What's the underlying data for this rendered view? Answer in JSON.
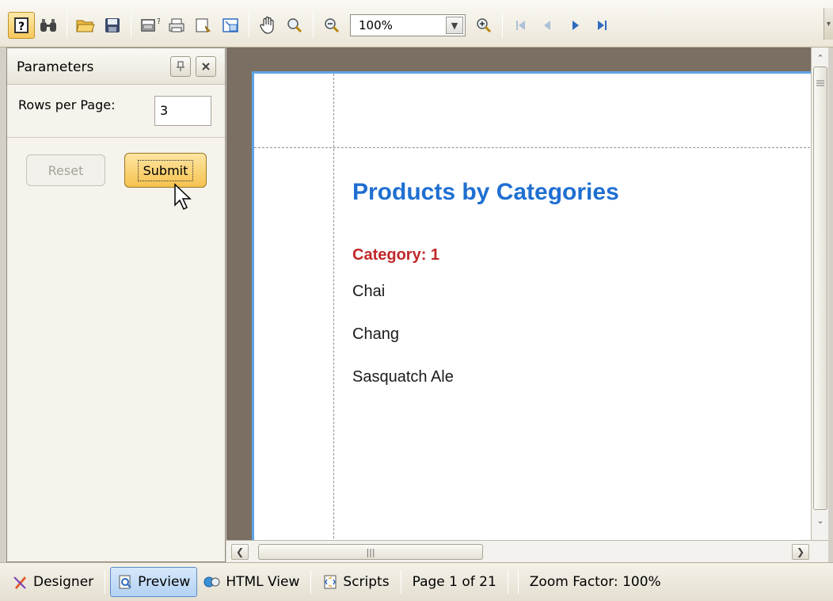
{
  "toolbar": {
    "icons": [
      "document-map-icon",
      "find-icon",
      "open-icon",
      "save-icon",
      "page-setup-icon",
      "print-icon",
      "quick-print-icon",
      "export-icon",
      "hand-tool-icon",
      "magnifier-icon",
      "zoom-out-icon",
      "zoom-in-icon",
      "first-page-icon",
      "prev-page-icon",
      "next-page-icon",
      "last-page-icon"
    ],
    "zoom_value": "100%"
  },
  "parameters": {
    "title": "Parameters",
    "rows_label": "Rows per Page:",
    "rows_value": "3",
    "reset_label": "Reset",
    "submit_label": "Submit"
  },
  "report": {
    "title": "Products by Categories",
    "category": "Category: 1",
    "products": [
      "Chai",
      "Chang",
      "Sasquatch Ale"
    ]
  },
  "tabs": {
    "designer": "Designer",
    "preview": "Preview",
    "html_view": "HTML View",
    "scripts": "Scripts"
  },
  "status": {
    "page": "Page 1 of 21",
    "zoom": "Zoom Factor: 100%"
  },
  "colors": {
    "report_title": "#1f6fd1",
    "category": "#c0282a",
    "page_border": "#5fa4e6",
    "active_button": "#f6c24e"
  }
}
